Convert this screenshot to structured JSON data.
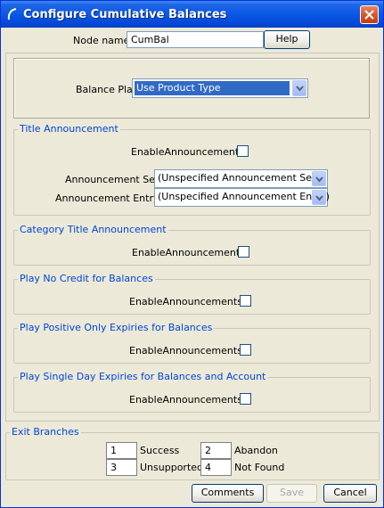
{
  "window": {
    "title": "Configure Cumulative Balances"
  },
  "node": {
    "label": "Node name",
    "value": "CumBal",
    "help_label": "Help"
  },
  "balance_plan": {
    "label": "Balance Plan",
    "value": "Use Product Type"
  },
  "title_announcement": {
    "title": "Title Announcement",
    "enable_label": "EnableAnnouncement",
    "set_label": "Announcement Set",
    "set_value": "(Unspecified Announcement Set)",
    "entry_label": "Announcement Entry",
    "entry_value": "(Unspecified Announcement Entry)"
  },
  "category_title": {
    "title": "Category Title Announcement",
    "enable_label": "EnableAnnouncement"
  },
  "no_credit": {
    "title": "Play No Credit for Balances",
    "enable_label": "EnableAnnouncements"
  },
  "positive_only": {
    "title": "Play Positive Only Expiries for Balances",
    "enable_label": "EnableAnnouncements"
  },
  "single_day": {
    "title": "Play Single Day Expiries for Balances and Account",
    "enable_label": "EnableAnnouncements"
  },
  "exit_branches": {
    "title": "Exit Branches",
    "items": [
      {
        "num": "1",
        "label": "Success"
      },
      {
        "num": "2",
        "label": "Abandon"
      },
      {
        "num": "3",
        "label": "Unsupported"
      },
      {
        "num": "4",
        "label": "Not Found"
      }
    ]
  },
  "footer": {
    "comments_label": "Comments",
    "save_label": "Save",
    "cancel_label": "Cancel"
  },
  "colors": {
    "titlebar": "#0a58e6",
    "group_title": "#0046d5",
    "selection": "#316ac5",
    "background": "#ece9d8"
  },
  "icons": {
    "app": "curved-stroke-icon",
    "close": "close-x-icon",
    "dropdown": "chevron-down-icon"
  }
}
